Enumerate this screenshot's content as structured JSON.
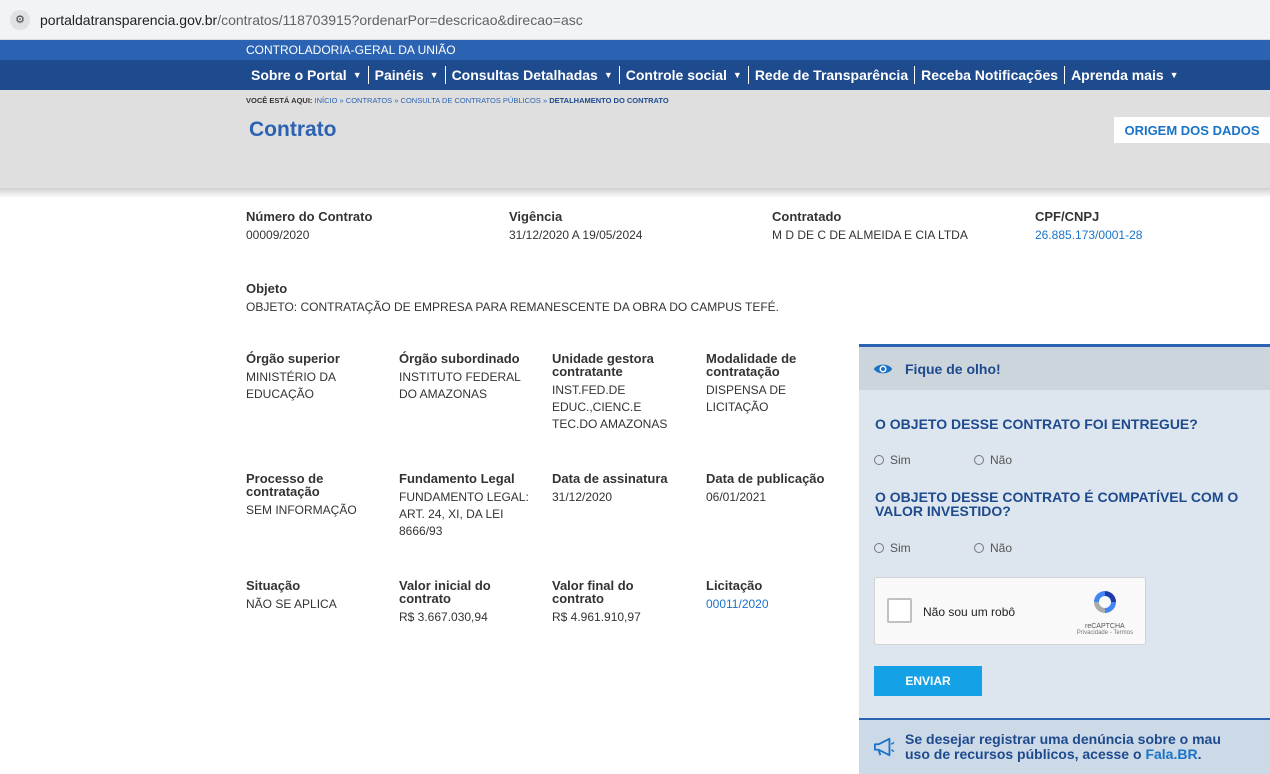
{
  "browser": {
    "url_host": "portaldatransparencia.gov.br",
    "url_path": "/contratos/118703915?ordenarPor=descricao&direcao=asc"
  },
  "govbar": {
    "text": "CONTROLADORIA-GERAL DA UNIÃO"
  },
  "nav": {
    "items": [
      {
        "label": "Sobre o Portal",
        "caret": "▼"
      },
      {
        "label": "Painéis",
        "caret": "▼"
      },
      {
        "label": "Consultas Detalhadas",
        "caret": "▼"
      },
      {
        "label": "Controle social",
        "caret": "▼"
      },
      {
        "label": "Rede de Transparência",
        "caret": ""
      },
      {
        "label": "Receba Notificações",
        "caret": ""
      },
      {
        "label": "Aprenda mais",
        "caret": "▼"
      }
    ]
  },
  "breadcrumb": {
    "prefix": "VOCÊ ESTÁ AQUI:",
    "items": [
      "INÍCIO",
      "CONTRATOS",
      "CONSULTA DE CONTRATOS PÚBLICOS"
    ],
    "separator": "»",
    "current": "DETALHAMENTO DO CONTRATO"
  },
  "page": {
    "title": "Contrato",
    "origem_label": "ORIGEM DOS DADOS"
  },
  "fields": {
    "numero": {
      "label": "Número do Contrato",
      "value": "00009/2020"
    },
    "vigencia": {
      "label": "Vigência",
      "value": "31/12/2020 A 19/05/2024"
    },
    "contratado": {
      "label": "Contratado",
      "value": "M D DE C DE ALMEIDA E CIA LTDA"
    },
    "cpf": {
      "label": "CPF/CNPJ",
      "value": "26.885.173/0001-28"
    },
    "objeto": {
      "label": "Objeto",
      "value": "OBJETO: CONTRATAÇÃO DE EMPRESA PARA REMANESCENTE DA OBRA DO CAMPUS TEFÉ."
    },
    "orgao_sup": {
      "label": "Órgão superior",
      "value": "MINISTÉRIO DA EDUCAÇÃO"
    },
    "orgao_sub": {
      "label": "Órgão subordinado",
      "value": "INSTITUTO FEDERAL DO AMAZONAS"
    },
    "unidade": {
      "label": "Unidade gestora contratante",
      "value": "INST.FED.DE EDUC.,CIENC.E TEC.DO AMAZONAS"
    },
    "modalidade": {
      "label": "Modalidade de contratação",
      "value": "DISPENSA DE LICITAÇÃO"
    },
    "processo": {
      "label": "Processo de contratação",
      "value": "SEM INFORMAÇÃO"
    },
    "fundamento": {
      "label": "Fundamento Legal",
      "value": "FUNDAMENTO LEGAL: ART. 24, XI, DA LEI 8666/93"
    },
    "assinatura": {
      "label": "Data de assinatura",
      "value": "31/12/2020"
    },
    "publicacao": {
      "label": "Data de publicação",
      "value": "06/01/2021"
    },
    "situacao": {
      "label": "Situação",
      "value": "NÃO SE APLICA"
    },
    "valor_ini": {
      "label": "Valor inicial do contrato",
      "value": "R$ 3.667.030,94"
    },
    "valor_fin": {
      "label": "Valor final do contrato",
      "value": "R$ 4.961.910,97"
    },
    "licitacao": {
      "label": "Licitação",
      "value": "00011/2020"
    }
  },
  "panel": {
    "title": "Fique de olho!",
    "q1": "O OBJETO DESSE CONTRATO FOI ENTREGUE?",
    "q2": "O OBJETO DESSE CONTRATO É COMPATÍVEL COM O VALOR INVESTIDO?",
    "yes": "Sim",
    "no": "Não",
    "captcha_label": "Não sou um robô",
    "captcha_brand": "reCAPTCHA",
    "captcha_links": "Privacidade - Termos",
    "submit": "ENVIAR"
  },
  "denuncia": {
    "line1": "Se desejar registrar uma denúncia sobre o mau",
    "line2_prefix": "uso de recursos públicos, acesse o ",
    "link": "Fala.BR",
    "line2_suffix": "."
  }
}
